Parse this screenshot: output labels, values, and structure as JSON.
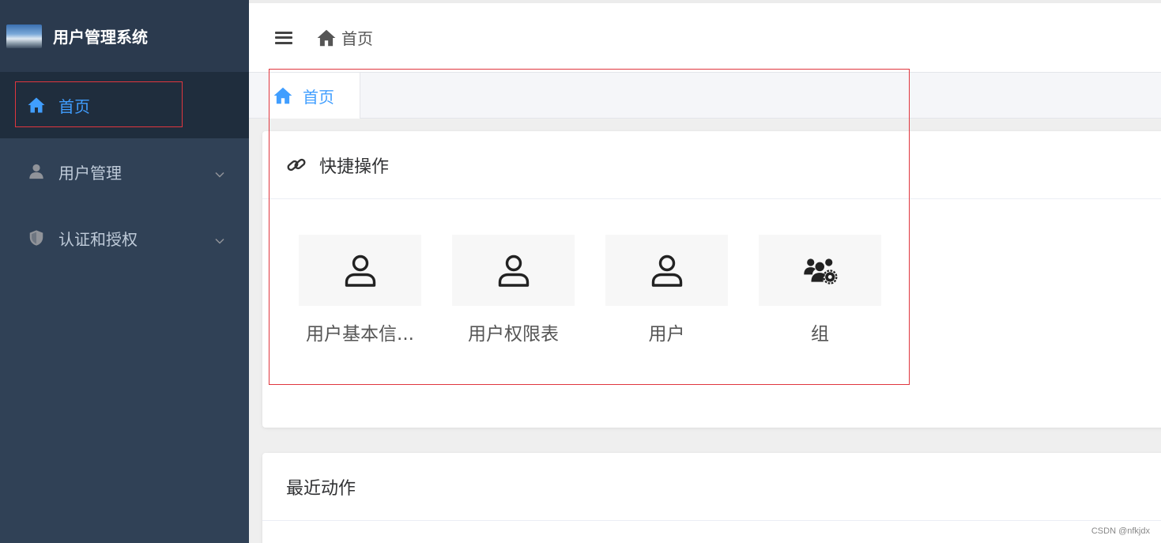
{
  "app": {
    "title": "用户管理系统"
  },
  "sidebar": {
    "items": [
      {
        "label": "首页",
        "icon": "home-icon",
        "active": true
      },
      {
        "label": "用户管理",
        "icon": "user-icon",
        "expandable": true
      },
      {
        "label": "认证和授权",
        "icon": "shield-icon",
        "expandable": true
      }
    ]
  },
  "header": {
    "breadcrumb": "首页"
  },
  "tags": [
    {
      "label": "首页",
      "icon": "home-icon",
      "active": true
    }
  ],
  "quick_actions": {
    "title": "快捷操作",
    "icon": "link-icon",
    "items": [
      {
        "label": "用户基本信...",
        "icon": "user-outline-icon"
      },
      {
        "label": "用户权限表",
        "icon": "user-outline-icon"
      },
      {
        "label": "用户",
        "icon": "user-outline-icon"
      },
      {
        "label": "组",
        "icon": "users-gear-icon"
      }
    ]
  },
  "recent": {
    "title": "最近动作"
  },
  "watermark": "CSDN @nfkjdx",
  "colors": {
    "sidebar_bg": "#304156",
    "accent": "#409eff",
    "highlight": "#e0363e"
  }
}
